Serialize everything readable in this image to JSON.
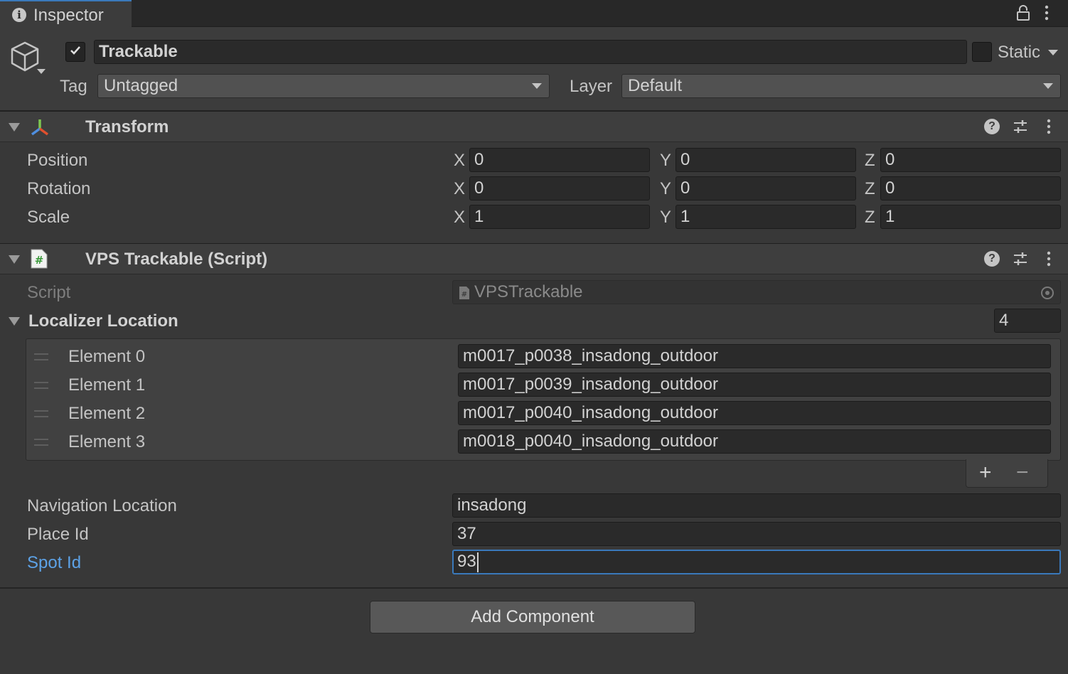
{
  "tab": {
    "title": "Inspector",
    "icon": "info-icon"
  },
  "header": {
    "active": true,
    "name": "Trackable",
    "static_label": "Static",
    "static_checked": false,
    "tag_label": "Tag",
    "tag_value": "Untagged",
    "layer_label": "Layer",
    "layer_value": "Default"
  },
  "transform": {
    "title": "Transform",
    "rows": [
      {
        "label": "Position",
        "x": "0",
        "y": "0",
        "z": "0"
      },
      {
        "label": "Rotation",
        "x": "0",
        "y": "0",
        "z": "0"
      },
      {
        "label": "Scale",
        "x": "1",
        "y": "1",
        "z": "1"
      }
    ],
    "axes": {
      "x": "X",
      "y": "Y",
      "z": "Z"
    }
  },
  "script_component": {
    "title": "VPS Trackable (Script)",
    "script_label": "Script",
    "script_value": "VPSTrackable",
    "localizer": {
      "label": "Localizer Location",
      "size": "4",
      "elements": [
        {
          "label": "Element 0",
          "value": "m0017_p0038_insadong_outdoor"
        },
        {
          "label": "Element 1",
          "value": "m0017_p0039_insadong_outdoor"
        },
        {
          "label": "Element 2",
          "value": "m0017_p0040_insadong_outdoor"
        },
        {
          "label": "Element 3",
          "value": "m0018_p0040_insadong_outdoor"
        }
      ],
      "add_symbol": "+",
      "remove_symbol": "−"
    },
    "navigation_label": "Navigation Location",
    "navigation_value": "insadong",
    "place_label": "Place Id",
    "place_value": "37",
    "spot_label": "Spot Id",
    "spot_value": "93"
  },
  "add_component_label": "Add Component",
  "colors": {
    "accent": "#3a79bb",
    "focused_label": "#5da2e6",
    "background": "#383838",
    "field": "#2a2a2a"
  }
}
